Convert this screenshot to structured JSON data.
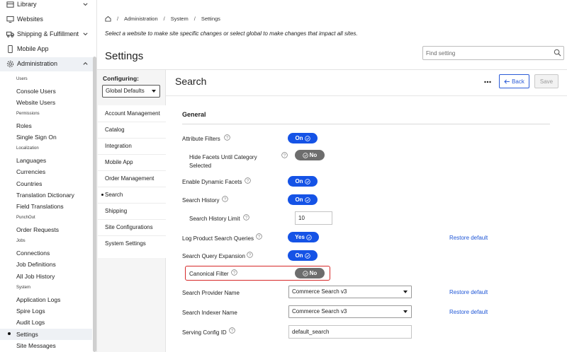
{
  "nav": {
    "top": [
      {
        "label": "Library"
      },
      {
        "label": "Websites"
      },
      {
        "label": "Shipping & Fulfillment"
      },
      {
        "label": "Mobile App"
      },
      {
        "label": "Administration"
      }
    ],
    "sections": {
      "users": "Users",
      "permissions": "Permissions",
      "localization": "Localization",
      "punchout": "PunchOut",
      "jobs": "Jobs",
      "system": "System"
    },
    "items": {
      "console_users": "Console Users",
      "website_users": "Website Users",
      "roles": "Roles",
      "sso": "Single Sign On",
      "languages": "Languages",
      "currencies": "Currencies",
      "countries": "Countries",
      "translation_dictionary": "Translation Dictionary",
      "field_translations": "Field Translations",
      "order_requests": "Order Requests",
      "connections": "Connections",
      "job_definitions": "Job Definitions",
      "all_job_history": "All Job History",
      "application_logs": "Application Logs",
      "spire_logs": "Spire Logs",
      "audit_logs": "Audit Logs",
      "settings": "Settings",
      "site_messages": "Site Messages"
    }
  },
  "breadcrumb": [
    "Administration",
    "System",
    "Settings"
  ],
  "intro_text": "Select a website to make site specific changes or select global to make changes that impact all sites.",
  "page_title": "Settings",
  "find_placeholder": "Find setting",
  "configuring": {
    "label": "Configuring:",
    "selected": "Global Defaults",
    "items": [
      "Account Management",
      "Catalog",
      "Integration",
      "Mobile App",
      "Order Management",
      "Search",
      "Shipping",
      "Site Configurations",
      "System Settings"
    ],
    "active": "Search"
  },
  "section": {
    "title": "Search",
    "back_label": "Back",
    "save_label": "Save",
    "group": "General"
  },
  "fields": {
    "attribute_filters": {
      "label": "Attribute Filters",
      "value": "On"
    },
    "hide_facets": {
      "label_line1": "Hide Facets Until Category",
      "label_line2": "Selected",
      "value": "No"
    },
    "dynamic_facets": {
      "label": "Enable Dynamic Facets",
      "value": "On"
    },
    "search_history": {
      "label": "Search History",
      "value": "On"
    },
    "search_history_limit": {
      "label": "Search History Limit",
      "value": "10"
    },
    "log_queries": {
      "label": "Log Product Search Queries",
      "value": "Yes",
      "restore": "Restore default"
    },
    "query_expansion": {
      "label": "Search Query Expansion",
      "value": "On"
    },
    "canonical_filter": {
      "label": "Canonical Filter",
      "value": "No"
    },
    "provider_name": {
      "label": "Search Provider Name",
      "value": "Commerce Search v3",
      "restore": "Restore default"
    },
    "indexer_name": {
      "label": "Search Indexer Name",
      "value": "Commerce Search v3",
      "restore": "Restore default"
    },
    "serving_config": {
      "label": "Serving Config ID",
      "value": "default_search"
    }
  },
  "colors": {
    "toggle_on": "#1553e6",
    "toggle_off": "#6d6d6d",
    "link": "#1f56d6",
    "highlight": "#d62828"
  }
}
